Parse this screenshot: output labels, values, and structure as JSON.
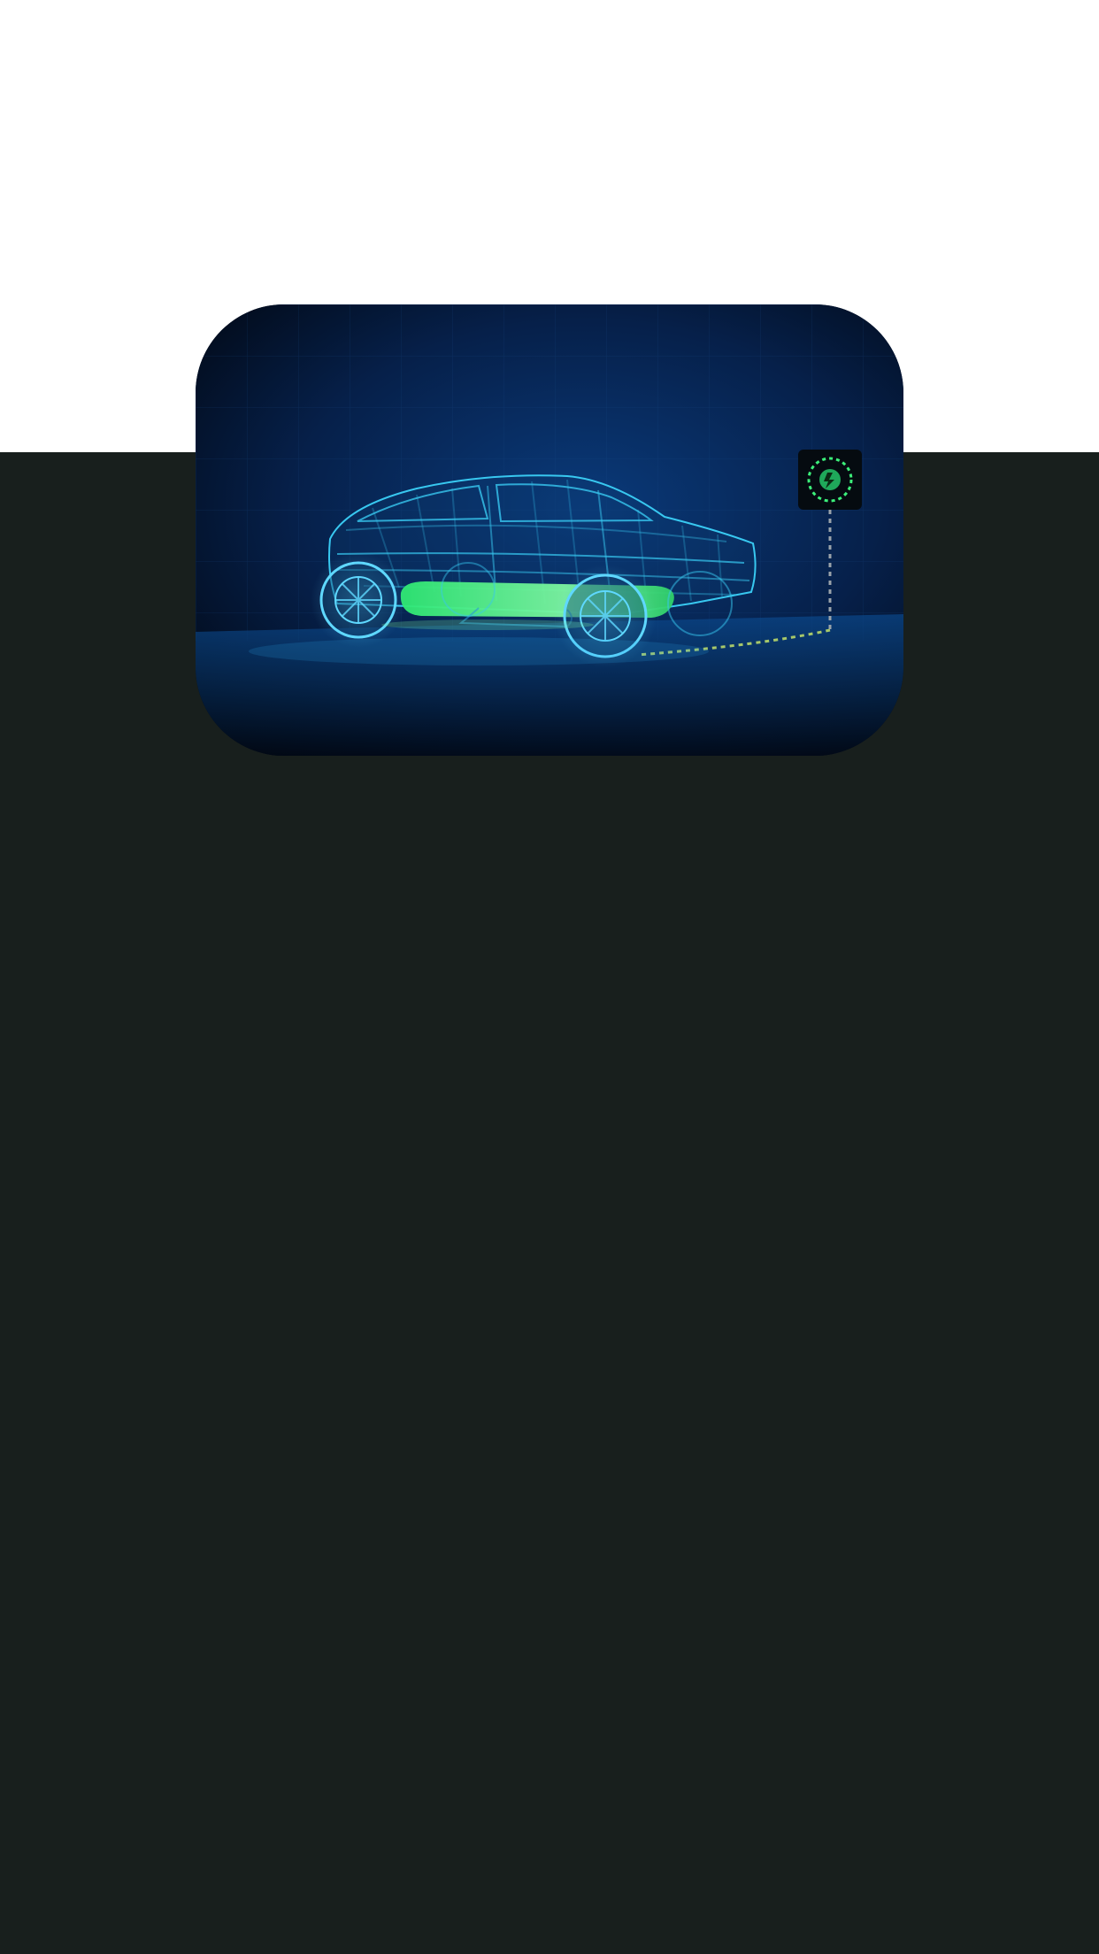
{
  "hero": {
    "illustration": "wireframe-electric-car-charging",
    "charger_icon": "charging-station-icon",
    "colors": {
      "page_top": "#ffffff",
      "panel": "#181f1d",
      "card_bg": "#020816",
      "wireframe": "#38c8f0",
      "battery": "#3cf07a",
      "charger_glow": "#3cf07a"
    }
  }
}
